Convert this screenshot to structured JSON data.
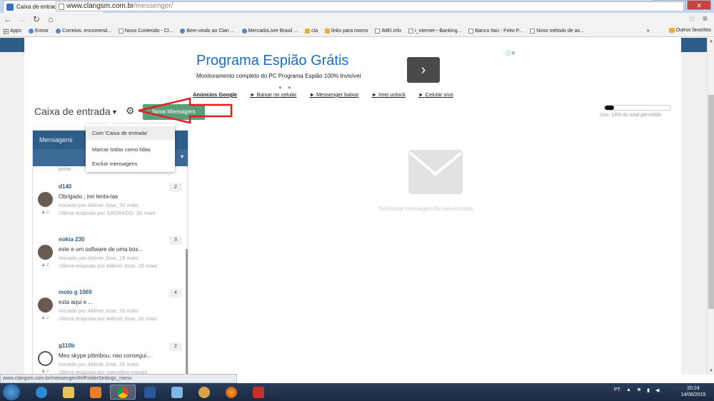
{
  "browser": {
    "tab_title": "Caixa de entrada - Clan GS",
    "url_host": "www.clangsm.com.br",
    "url_path": "/messenger/",
    "bookmarks": [
      {
        "label": "Apps",
        "kind": "apps"
      },
      {
        "label": "Entrar",
        "kind": "web"
      },
      {
        "label": "Correios: encomend...",
        "kind": "web"
      },
      {
        "label": "Novo Conteúdo - Cl...",
        "kind": "doc"
      },
      {
        "label": "Bem-vindo ao Clan ...",
        "kind": "web"
      },
      {
        "label": "MercadoLivre Brasil ...",
        "kind": "web"
      },
      {
        "label": "cla",
        "kind": "folder"
      },
      {
        "label": "links para rooms",
        "kind": "folder"
      },
      {
        "label": "IMEI.info",
        "kind": "doc"
      },
      {
        "label": "i_nternet---Banking...",
        "kind": "doc"
      },
      {
        "label": "Banco Itaú - Feito P...",
        "kind": "doc"
      },
      {
        "label": "Novo método de as...",
        "kind": "doc"
      }
    ],
    "bookmarks_more": "»",
    "other_bookmarks": "Outros favoritos",
    "status_url": "www.clangsm.com.br/messenger/#elFolderSettings_menu"
  },
  "ad": {
    "title": "Programa Espião Grátis",
    "description": "Monitoramento completo do PC Programa Espião 100% Invisível",
    "go_symbol": "›",
    "dots": "● ●",
    "sponsor_label": "Anúncios Google",
    "links": [
      "► Baixar no celular",
      "► Messenger baixar",
      "► Imei unlock",
      "► Celular vivo"
    ]
  },
  "messenger": {
    "folder_title": "Caixa de entrada",
    "new_message_label": "Nova Mensagem",
    "usage_text": "Uso: 14% do total permitido",
    "usage_fraction": 0.14,
    "sidebar_title": "Mensagens",
    "top_fragment": "junho",
    "empty_text": "Nenhuma mensagem foi selecionada"
  },
  "dropdown": {
    "items": [
      {
        "label": "Com 'Caixa de entrada'",
        "active": true
      },
      {
        "label": "Marcar todas como lidas",
        "active": false
      },
      {
        "label": "Excluir mensagens",
        "active": false
      }
    ]
  },
  "conversations": [
    {
      "title": "d140",
      "snippet": "Obrigado , irei tenta-las",
      "started": "Iniciado por Aldinei Jose, 30 maio",
      "last": "Última resposta por SAGRADO, 30 maio",
      "count": "2",
      "participants": "2"
    },
    {
      "title": "nokia 230",
      "snippet": "este e um software de uma box...",
      "started": "Iniciado por Aldinei Jose, 28 maio",
      "last": "Última resposta por Aldinei Jose, 28 maio",
      "count": "3",
      "participants": "2"
    },
    {
      "title": "moto g 1069",
      "snippet": "esta aqui e   ...",
      "started": "Iniciado por Aldinei Jose, 25 maio",
      "last": "Última resposta por Aldinei Jose, 26 maio",
      "count": "4",
      "participants": "2"
    },
    {
      "title": "g110b",
      "snippet": "Meu skype pitimbou, nao consegui...",
      "started": "Iniciado por Aldinei Jose, 20 maio",
      "last": "Última resposta por marcelino morais",
      "count": "2",
      "participants": "2"
    }
  ],
  "taskbar": {
    "language": "PT",
    "time": "20:24",
    "date": "14/06/2015"
  },
  "colors": {
    "accent_blue": "#2f5d8a",
    "new_message_green": "#5a9e7a",
    "ad_title_blue": "#1a6fc9",
    "annotation_red": "#e02020"
  }
}
